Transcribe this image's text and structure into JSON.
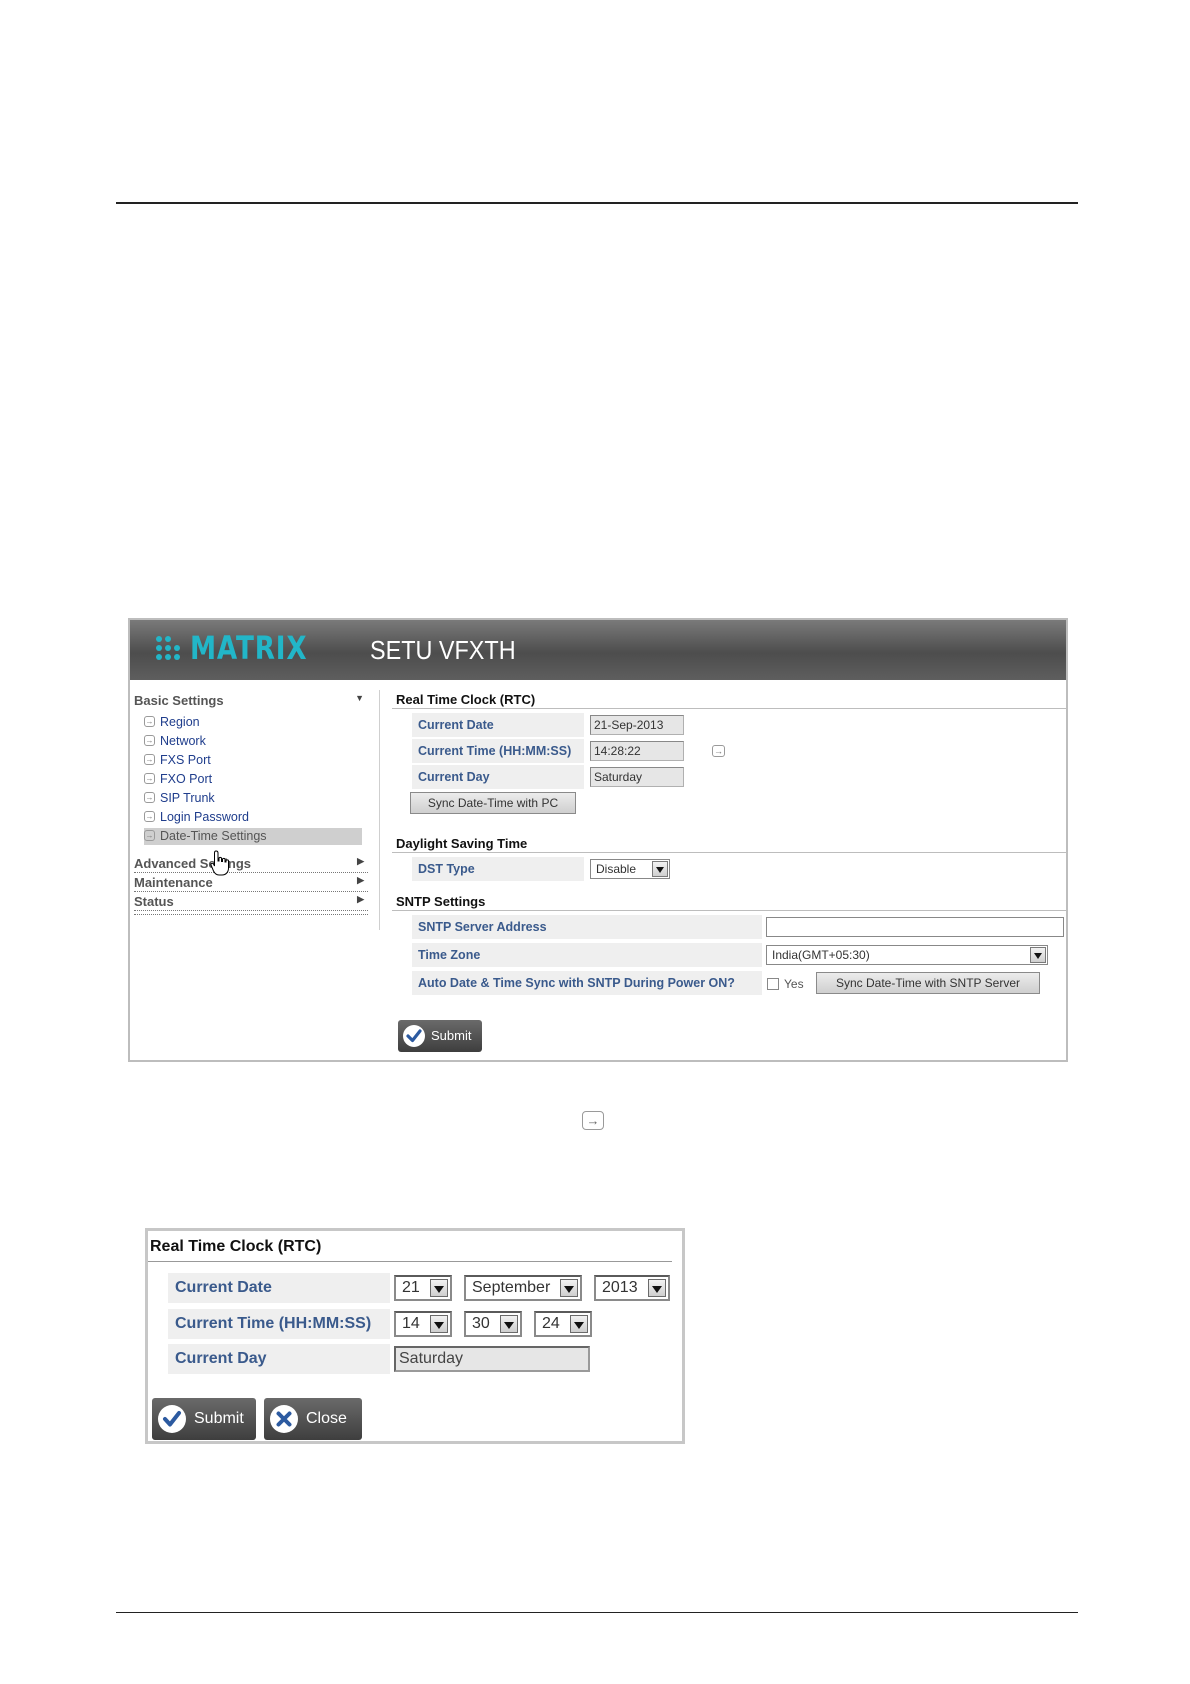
{
  "app": {
    "logo_text": "MATRIX",
    "product_name": "SETU VFXTH"
  },
  "sidebar": {
    "basic_settings": "Basic Settings",
    "items": [
      "Region",
      "Network",
      "FXS Port",
      "FXO Port",
      "SIP Trunk",
      "Login Password",
      "Date-Time Settings"
    ],
    "selected_item": "Date-Time Settings",
    "advanced_settings": "Advanced Settings",
    "maintenance": "Maintenance",
    "status": "Status"
  },
  "rtc": {
    "title": "Real Time Clock (RTC)",
    "current_date_label": "Current Date",
    "current_date_value": "21-Sep-2013",
    "current_time_label": "Current Time (HH:MM:SS)",
    "current_time_value": "14:28:22",
    "current_day_label": "Current Day",
    "current_day_value": "Saturday",
    "sync_pc_button": "Sync Date-Time with PC"
  },
  "dst": {
    "title": "Daylight Saving Time",
    "type_label": "DST Type",
    "type_value": "Disable"
  },
  "sntp": {
    "title": "SNTP Settings",
    "server_label": "SNTP Server Address",
    "server_value": "",
    "timezone_label": "Time Zone",
    "timezone_value": "India(GMT+05:30)",
    "auto_sync_label": "Auto Date & Time Sync with SNTP During Power ON?",
    "auto_sync_checkbox_label": "Yes",
    "auto_sync_checked": false,
    "sync_sntp_button": "Sync Date-Time with SNTP Server"
  },
  "submit_button": "Submit",
  "edit_dialog": {
    "title": "Real Time Clock (RTC)",
    "current_date_label": "Current Date",
    "day": "21",
    "month": "September",
    "year": "2013",
    "current_time_label": "Current Time (HH:MM:SS)",
    "hour": "14",
    "minute": "30",
    "second": "24",
    "current_day_label": "Current Day",
    "current_day_value": "Saturday",
    "submit_button": "Submit",
    "close_button": "Close"
  },
  "colors": {
    "brand": "#22b6c8",
    "label_blue": "#3a5a8c",
    "link_blue": "#1f3d8c"
  }
}
